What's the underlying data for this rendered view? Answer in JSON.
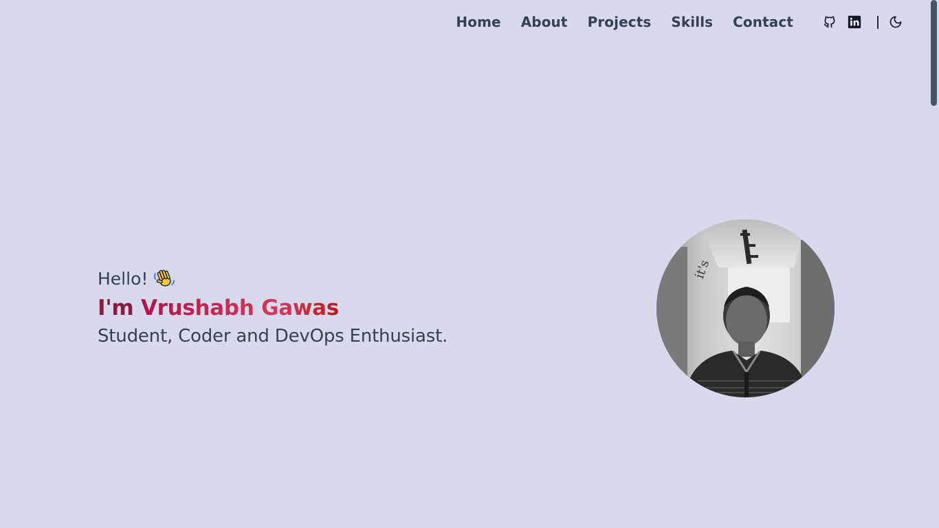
{
  "nav": {
    "links": [
      "Home",
      "About",
      "Projects",
      "Skills",
      "Contact"
    ],
    "icons": [
      "github-icon",
      "linkedin-icon",
      "moon-icon"
    ]
  },
  "hero": {
    "greeting": "Hello!",
    "greeting_emoji": "waving-hand-icon",
    "name_prefix": "I'm",
    "name": "Vrushabh Gawas",
    "tagline": "Student, Coder and DevOps Enthusiast."
  },
  "colors": {
    "background": "#d6daec",
    "text": "#334155",
    "name_gradient_start": "#b3124a",
    "name_gradient_end": "#b91c1c",
    "scrollbar_thumb": "#475569"
  }
}
